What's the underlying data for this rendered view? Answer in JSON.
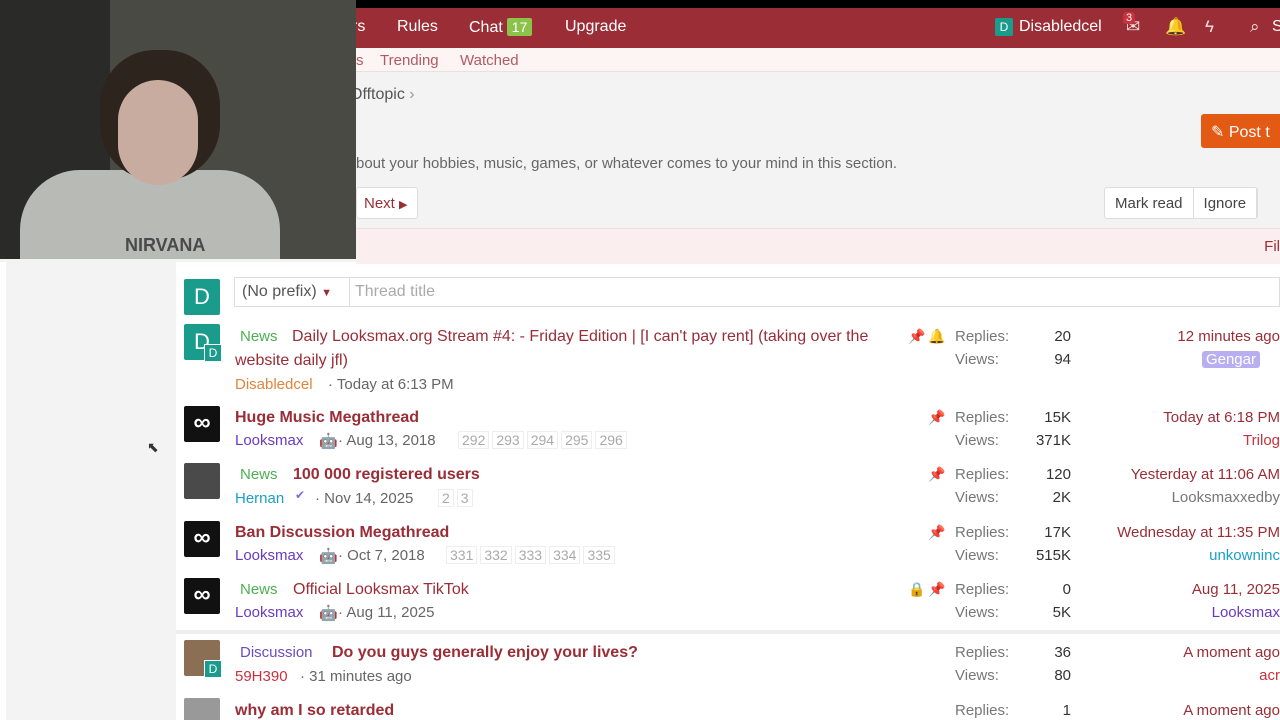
{
  "nav": {
    "items": [
      "rs",
      "Rules",
      "Chat",
      "Upgrade"
    ],
    "chat_count": "17",
    "user": "Disabledcel",
    "user_initial": "D",
    "inbox_count": "3",
    "search_label": "S"
  },
  "subnav": [
    "s",
    "Trending",
    "Watched"
  ],
  "breadcrumb": "Offtopic",
  "post_button": "Post t",
  "description": "bout your hobbies, music, games, or whatever comes to your mind in this section.",
  "next_button": "Next",
  "actions": [
    "Mark read",
    "Ignore"
  ],
  "filter_label": "Fil",
  "quick_thread": {
    "avatar_initial": "D",
    "prefix_value": "(No prefix)",
    "title_placeholder": "Thread title"
  },
  "labels": {
    "replies": "Replies:",
    "views": "Views:"
  },
  "threads": [
    {
      "prefix": "News",
      "title_line1": "Daily Looksmax.org Stream #4: - Friday Edition | [I can't pay rent] (taking over the",
      "title_line2": "website daily jfl)",
      "author": "Disabledcel",
      "date": "Today at 6:13 PM",
      "pages": [],
      "replies": "20",
      "views": "94",
      "last_time": "12 minutes ago",
      "last_user": "Gengar"
    },
    {
      "prefix": "",
      "title_line1": "Huge Music Megathread",
      "author": "Looksmax",
      "date": "Aug 13, 2018",
      "pages": [
        "292",
        "293",
        "294",
        "295",
        "296"
      ],
      "replies": "15K",
      "views": "371K",
      "last_time": "Today at 6:18 PM",
      "last_user": "Trilog"
    },
    {
      "prefix": "News",
      "title_line1": "100 000 registered users",
      "author": "Hernan",
      "date": "Nov 14, 2025",
      "pages": [
        "2",
        "3"
      ],
      "replies": "120",
      "views": "2K",
      "last_time": "Yesterday at 11:06 AM",
      "last_user": "Looksmaxxedby"
    },
    {
      "prefix": "",
      "title_line1": "Ban Discussion Megathread",
      "author": "Looksmax",
      "date": "Oct 7, 2018",
      "pages": [
        "331",
        "332",
        "333",
        "334",
        "335"
      ],
      "replies": "17K",
      "views": "515K",
      "last_time": "Wednesday at 11:35 PM",
      "last_user": "unkowninc"
    },
    {
      "prefix": "News",
      "title_line1": "Official Looksmax TikTok",
      "author": "Looksmax",
      "date": "Aug 11, 2025",
      "pages": [],
      "replies": "0",
      "views": "5K",
      "last_time": "Aug 11, 2025",
      "last_user": "Looksmax"
    },
    {
      "prefix": "Discussion",
      "title_line1": "Do you guys generally enjoy your lives?",
      "author": "59H390",
      "date": "31 minutes ago",
      "pages": [],
      "replies": "36",
      "views": "80",
      "last_time": "A moment ago",
      "last_user": "acr"
    },
    {
      "prefix": "",
      "title_line1": "why am I so retarded",
      "author": "",
      "date": "",
      "pages": [],
      "replies": "1",
      "views": "",
      "last_time": "A moment ago",
      "last_user": ""
    }
  ],
  "webcam": {
    "shirt_print": "NIRVANA"
  }
}
